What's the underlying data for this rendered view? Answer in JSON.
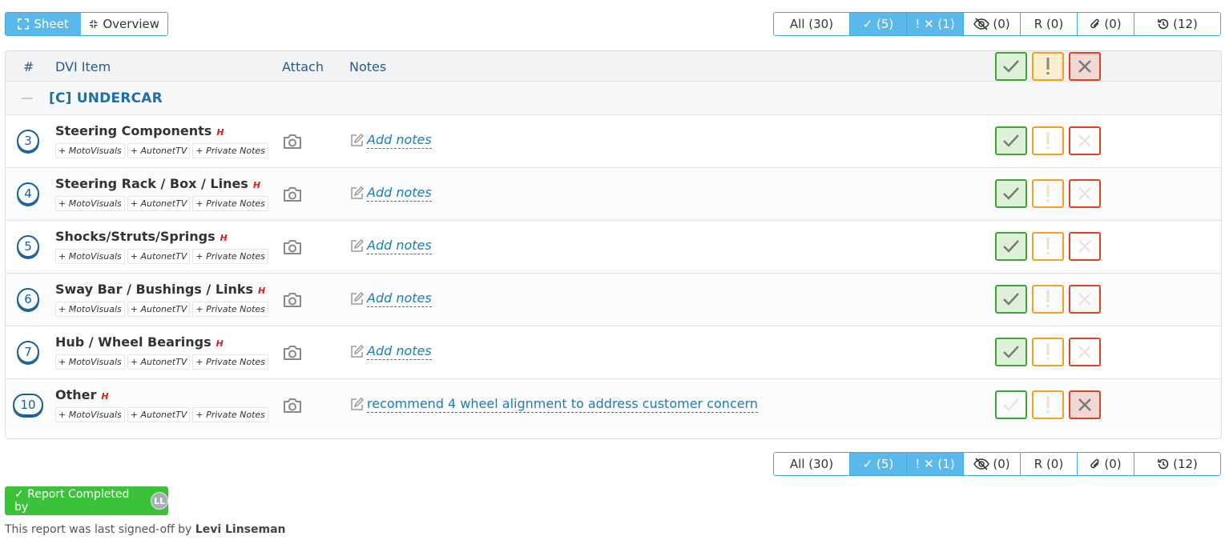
{
  "view_toggle": {
    "sheet": "Sheet",
    "overview": "Overview"
  },
  "filters": {
    "all": "All (30)",
    "ok": "✓ (5)",
    "warn": "! ✕ (1)",
    "hidden": "(0)",
    "r": "R (0)",
    "attach": "(0)",
    "history": "(12)"
  },
  "table": {
    "headers": {
      "num": "#",
      "item": "DVI Item",
      "attach": "Attach",
      "notes": "Notes"
    },
    "group": {
      "title": "[C] UNDERCAR"
    },
    "tags": [
      "+ MotoVisuals",
      "+ AutonetTV",
      "+ Private Notes"
    ],
    "h_flag": "H",
    "rows": [
      {
        "num": "3",
        "name": "Steering Components",
        "notes": "Add notes",
        "status": "ok"
      },
      {
        "num": "4",
        "name": "Steering Rack / Box / Lines",
        "notes": "Add notes",
        "status": "ok"
      },
      {
        "num": "5",
        "name": "Shocks/Struts/Springs",
        "notes": "Add notes",
        "status": "ok"
      },
      {
        "num": "6",
        "name": "Sway Bar / Bushings / Links",
        "notes": "Add notes",
        "status": "ok"
      },
      {
        "num": "7",
        "name": "Hub / Wheel Bearings",
        "notes": "Add notes",
        "status": "ok"
      },
      {
        "num": "10",
        "name": "Other",
        "notes": "recommend 4 wheel alignment to address customer concern",
        "status": "bad"
      }
    ]
  },
  "footer": {
    "report_button": "✓ Report Completed by",
    "avatar_initials": "LL",
    "signoff_prefix": "This report was last signed-off by ",
    "signoff_name": "Levi Linseman"
  },
  "colors": {
    "accent": "#5bb8ea",
    "ok": "#3fa337",
    "warn": "#f3a21f",
    "bad": "#e3401e",
    "link": "#1a7bbf",
    "complete": "#3cc13b"
  }
}
